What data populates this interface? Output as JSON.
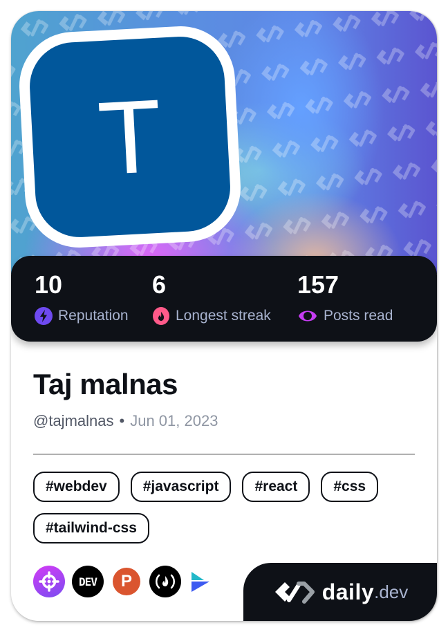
{
  "profile": {
    "avatar_initial": "T",
    "avatar_color": "#01579b",
    "name": "Taj malnas",
    "username": "@tajmalnas",
    "separator": "•",
    "joined": "Jun 01, 2023"
  },
  "stats": [
    {
      "value": "10",
      "label": "Reputation",
      "icon": "reputation-lightning-icon",
      "color": "#6e4af0"
    },
    {
      "value": "6",
      "label": "Longest streak",
      "icon": "streak-flame-icon",
      "color": "#ff5a8a"
    },
    {
      "value": "157",
      "label": "Posts read",
      "icon": "posts-read-ring-icon",
      "color": "#c53cf2"
    }
  ],
  "tags": [
    "#webdev",
    "#javascript",
    "#react",
    "#css",
    "#tailwind-css"
  ],
  "sources": [
    {
      "name": "crosshair-source-icon",
      "text": ""
    },
    {
      "name": "dev-to-icon",
      "text": "DEV"
    },
    {
      "name": "product-hunt-icon",
      "text": "P"
    },
    {
      "name": "freecodecamp-icon",
      "text": "(🔥)"
    },
    {
      "name": "arrow-source-icon",
      "text": ""
    }
  ],
  "brand": {
    "name": "daily",
    "tld": ".dev"
  },
  "colors": {
    "dark": "#0e1117",
    "label": "#a8b3cf"
  }
}
